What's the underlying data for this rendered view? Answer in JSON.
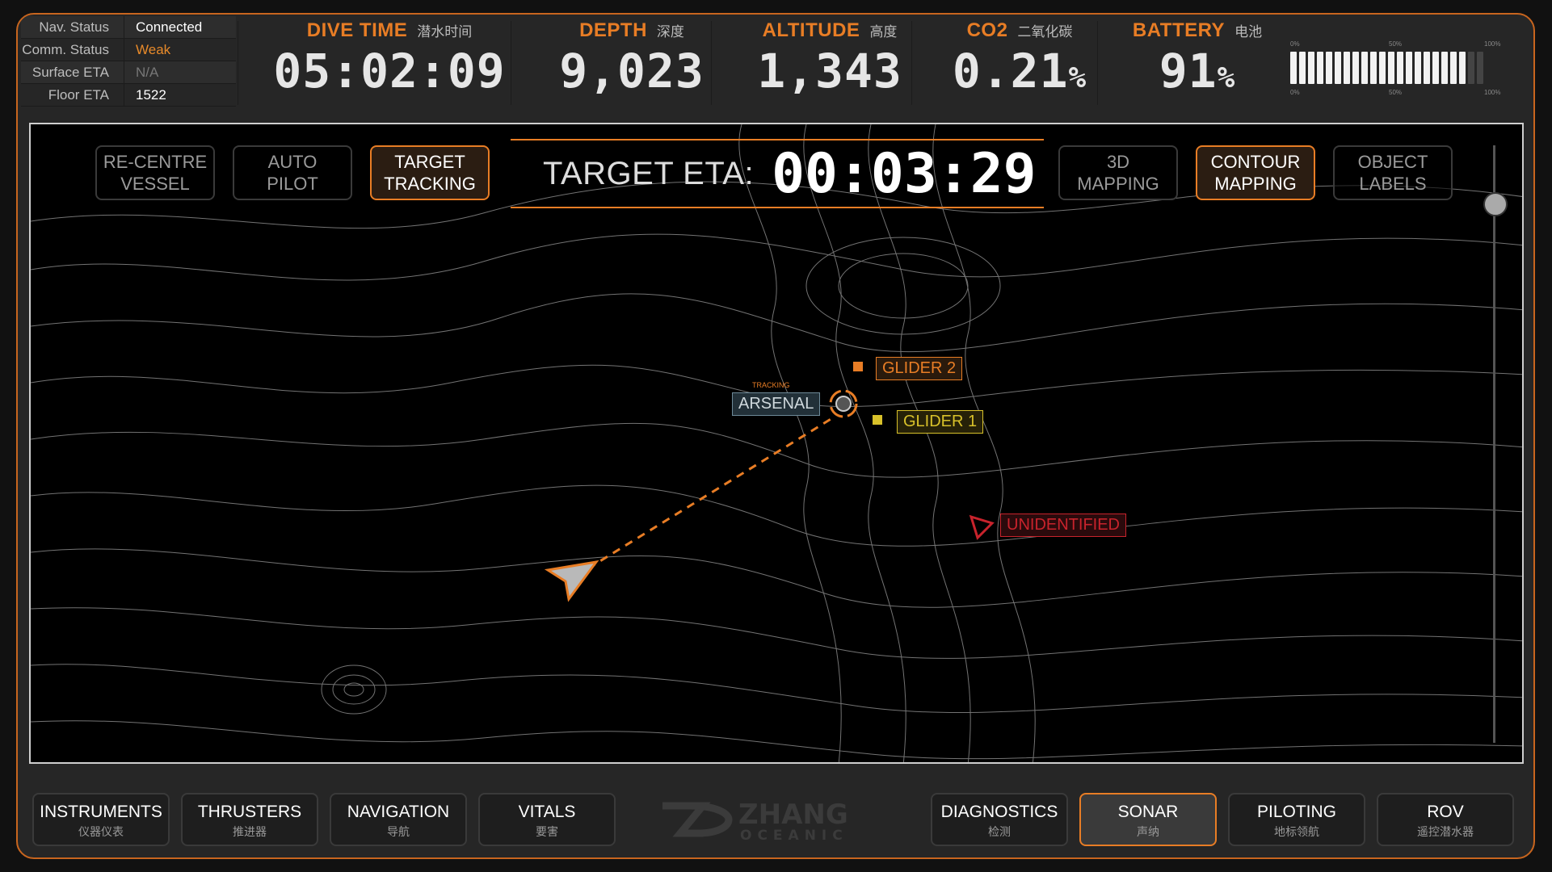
{
  "status": [
    {
      "label": "Nav. Status",
      "value": "Connected"
    },
    {
      "label": "Comm. Status",
      "value": "Weak"
    },
    {
      "label": "Surface ETA",
      "value": "N/A"
    },
    {
      "label": "Floor ETA",
      "value": "1522"
    }
  ],
  "metrics": {
    "dive_time": {
      "label": "DIVE TIME",
      "cn": "潜水时间",
      "value": "05:02:09"
    },
    "depth": {
      "label": "DEPTH",
      "cn": "深度",
      "value": "9,023"
    },
    "altitude": {
      "label": "ALTITUDE",
      "cn": "高度",
      "value": "1,343"
    },
    "co2": {
      "label": "CO2",
      "cn": "二氧化碳",
      "value": "0.21",
      "unit": "%"
    },
    "battery": {
      "label": "BATTERY",
      "cn": "电池",
      "value": "91",
      "unit": "%",
      "level": 0.91,
      "scale": [
        "0%",
        "50%",
        "100%"
      ]
    }
  },
  "map_buttons": {
    "recentre": "RE-CENTRE\nVESSEL",
    "autopilot": "AUTO\nPILOT",
    "target": "TARGET\nTRACKING",
    "mapping3d": "3D\nMAPPING",
    "contour": "CONTOUR\nMAPPING",
    "labels": "OBJECT\nLABELS"
  },
  "eta": {
    "label": "TARGET ETA:",
    "value": "00:03:29"
  },
  "objects": {
    "tracking": "TRACKING",
    "arsenal": "ARSENAL",
    "glider2": "GLIDER 2",
    "glider1": "GLIDER 1",
    "unidentified": "UNIDENTIFIED"
  },
  "nav": [
    {
      "a": "INSTRUMENTS",
      "b": "仪器仪表"
    },
    {
      "a": "THRUSTERS",
      "b": "推进器"
    },
    {
      "a": "NAVIGATION",
      "b": "导航"
    },
    {
      "a": "VITALS",
      "b": "要害"
    },
    {
      "a": "DIAGNOSTICS",
      "b": "检测"
    },
    {
      "a": "SONAR",
      "b": "声纳"
    },
    {
      "a": "PILOTING",
      "b": "地标领航"
    },
    {
      "a": "ROV",
      "b": "遥控潜水器"
    }
  ],
  "logo": {
    "name": "ZHANG",
    "sub": "OCEANIC"
  },
  "colors": {
    "accent": "#e87d25",
    "glider1": "#d8c12a",
    "hostile": "#c8232c",
    "tracking": "#6e8a99"
  }
}
